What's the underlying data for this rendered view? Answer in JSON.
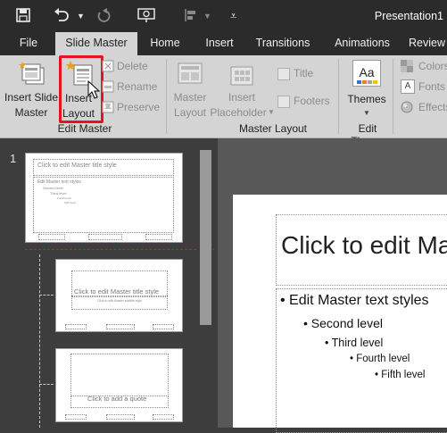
{
  "app": {
    "title": "Presentation1"
  },
  "tabs": [
    {
      "label": "File"
    },
    {
      "label": "Slide Master"
    },
    {
      "label": "Home"
    },
    {
      "label": "Insert"
    },
    {
      "label": "Transitions"
    },
    {
      "label": "Animations"
    },
    {
      "label": "Review"
    }
  ],
  "ribbon": {
    "edit_master": {
      "group_label": "Edit Master",
      "insert_slide_master": [
        "Insert Slide",
        "Master"
      ],
      "insert_layout": [
        "Insert",
        "Layout"
      ],
      "delete": "Delete",
      "rename": "Rename",
      "preserve": "Preserve"
    },
    "master_layout": {
      "group_label": "Master Layout",
      "master_layout": [
        "Master",
        "Layout"
      ],
      "insert_placeholder": [
        "Insert",
        "Placeholder"
      ],
      "title": "Title",
      "footers": "Footers"
    },
    "edit_theme": {
      "group_label": "Edit Theme",
      "themes": "Themes",
      "colors": "Colors",
      "fonts": "Fonts",
      "effects": "Effects"
    }
  },
  "thumbnails": {
    "master_number": "1",
    "master_title": "Click to edit Master title style",
    "master_text": [
      "Edit Master text styles",
      "Second level",
      "Third level",
      "Fourth level",
      "Fifth level"
    ],
    "layout1_title": "Click to edit Master title style",
    "layout1_subtitle": "Click to edit Master subtitle style",
    "layout2_quote": "Click to add a quote"
  },
  "slide": {
    "title": "Click to edit Master title style",
    "levels": [
      "Edit Master text styles",
      "Second level",
      "Third level",
      "Fourth level",
      "Fifth level"
    ]
  },
  "colors": {
    "highlight": "#e81123",
    "accent": "#d24726"
  }
}
